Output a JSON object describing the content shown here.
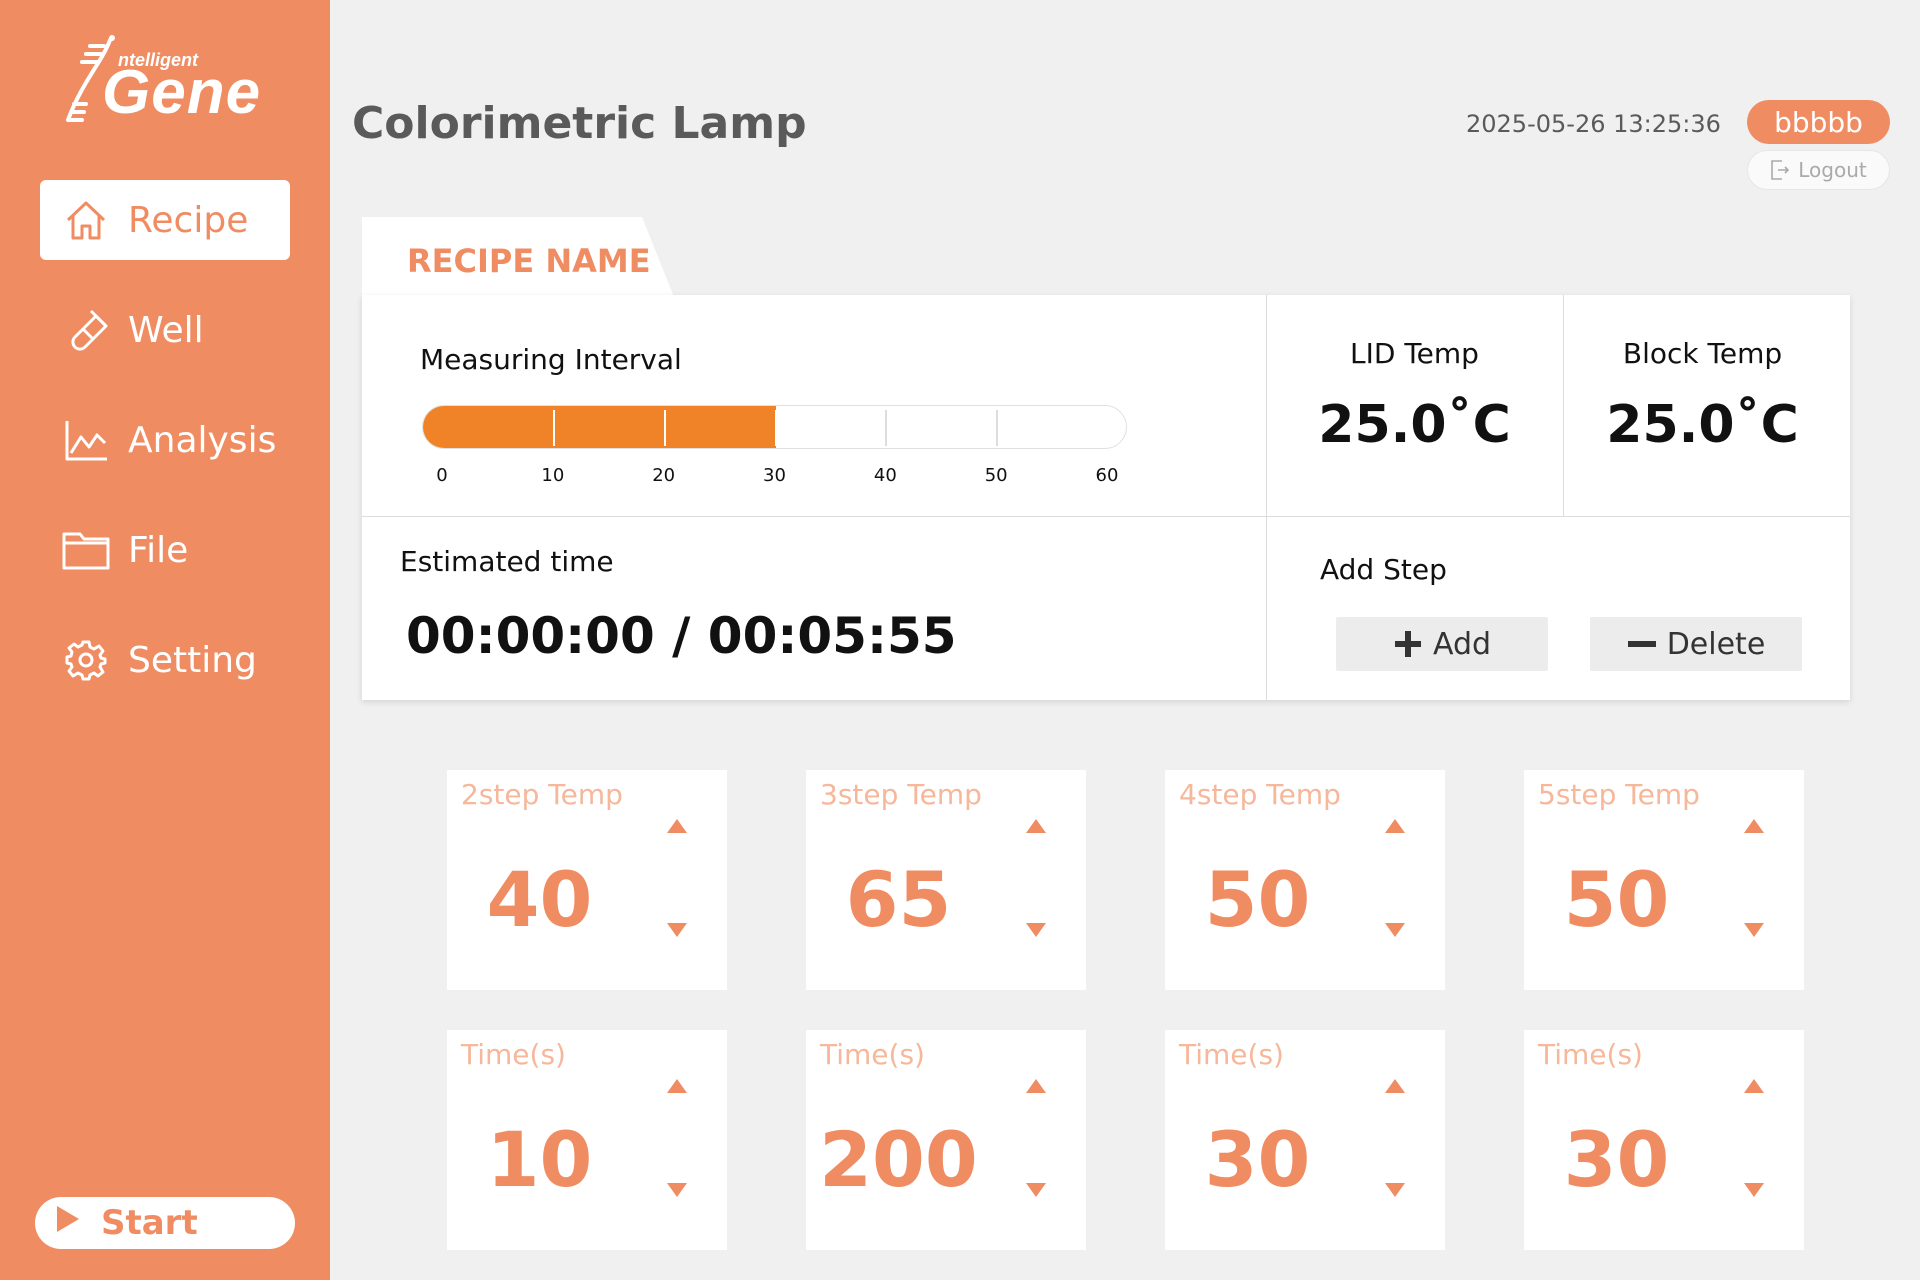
{
  "app": {
    "logo_small": "ntelligent",
    "logo_big": "Gene",
    "brand_color": "#f08c62",
    "progress_color": "#f08327"
  },
  "sidebar": {
    "items": [
      {
        "label": "Recipe",
        "icon": "home-icon",
        "active": true
      },
      {
        "label": "Well",
        "icon": "test-tube-icon",
        "active": false
      },
      {
        "label": "Analysis",
        "icon": "line-chart-icon",
        "active": false
      },
      {
        "label": "File",
        "icon": "folder-icon",
        "active": false
      },
      {
        "label": "Setting",
        "icon": "gear-icon",
        "active": false
      }
    ],
    "start_label": "Start"
  },
  "header": {
    "title": "Colorimetric Lamp",
    "datetime": "2025-05-26 13:25:36",
    "user": "bbbbb",
    "logout_label": "Logout"
  },
  "recipe": {
    "tab_label": "RECIPE NAME",
    "measuring_interval": {
      "label": "Measuring Interval",
      "value": 30,
      "min": 0,
      "max": 60,
      "ticks": [
        "0",
        "10",
        "20",
        "30",
        "40",
        "50",
        "60"
      ]
    },
    "lid_temp": {
      "label": "LID Temp",
      "value": "25.0˚C"
    },
    "block_temp": {
      "label": "Block Temp",
      "value": "25.0˚C"
    },
    "estimated_time": {
      "label": "Estimated time",
      "value": "00:00:00 / 00:05:55"
    },
    "add_step": {
      "label": "Add Step",
      "add_label": "Add",
      "delete_label": "Delete"
    }
  },
  "steps": [
    {
      "temp_label": "2step Temp",
      "temp": "40",
      "time_label": "Time(s)",
      "time": "10"
    },
    {
      "temp_label": "3step Temp",
      "temp": "65",
      "time_label": "Time(s)",
      "time": "200"
    },
    {
      "temp_label": "4step Temp",
      "temp": "50",
      "time_label": "Time(s)",
      "time": "30"
    },
    {
      "temp_label": "5step Temp",
      "temp": "50",
      "time_label": "Time(s)",
      "time": "30"
    }
  ]
}
